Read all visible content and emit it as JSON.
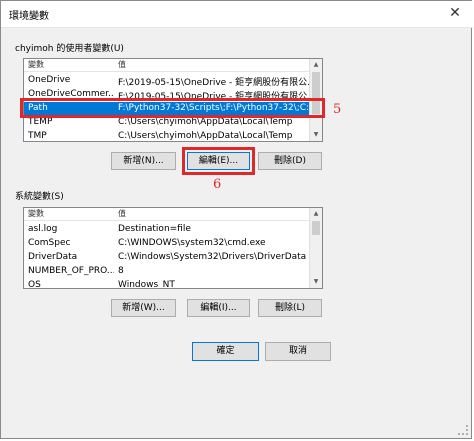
{
  "window": {
    "title": "環境變數",
    "close_glyph": "✕"
  },
  "user_vars": {
    "group_label": "chyimoh 的使用者變數(U)",
    "columns": [
      "變數",
      "值"
    ],
    "rows": [
      {
        "name": "OneDrive",
        "value": "F:\\2019-05-15\\OneDrive - 鉅亨網股份有限公..."
      },
      {
        "name": "OneDriveCommer...",
        "value": "F:\\2019-05-15\\OneDrive - 鉅亨網股份有限公..."
      },
      {
        "name": "Path",
        "value": "F:\\Python37-32\\Scripts\\;F:\\Python37-32\\;C:\\..."
      },
      {
        "name": "TEMP",
        "value": "C:\\Users\\chyimoh\\AppData\\Local\\Temp"
      },
      {
        "name": "TMP",
        "value": "C:\\Users\\chyimoh\\AppData\\Local\\Temp"
      }
    ],
    "selected_index": 2,
    "buttons": {
      "new": "新增(N)...",
      "edit": "編輯(E)...",
      "delete": "刪除(D)"
    }
  },
  "system_vars": {
    "group_label": "系統變數(S)",
    "columns": [
      "變數",
      "值"
    ],
    "rows": [
      {
        "name": "asl.log",
        "value": "Destination=file"
      },
      {
        "name": "ComSpec",
        "value": "C:\\WINDOWS\\system32\\cmd.exe"
      },
      {
        "name": "DriverData",
        "value": "C:\\Windows\\System32\\Drivers\\DriverData"
      },
      {
        "name": "NUMBER_OF_PRO...",
        "value": "8"
      },
      {
        "name": "OS",
        "value": "Windows_NT"
      }
    ],
    "buttons": {
      "new": "新增(W)...",
      "edit": "編輯(I)...",
      "delete": "刪除(L)"
    }
  },
  "footer": {
    "ok": "確定",
    "cancel": "取消"
  },
  "annotations": {
    "path_marker": "5",
    "edit_marker": "6",
    "color": "#e0282a"
  },
  "colors": {
    "selection": "#0078d7",
    "dialog_bg": "#f0f0f0"
  }
}
